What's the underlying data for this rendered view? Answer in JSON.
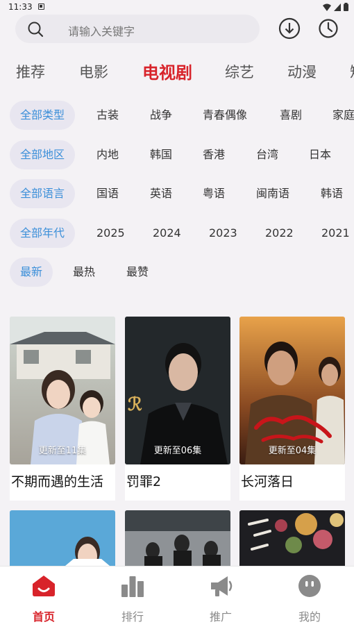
{
  "status_bar": {
    "time": "11:33"
  },
  "search": {
    "placeholder": "请输入关键字"
  },
  "tabs": [
    {
      "label": "推荐",
      "active": false
    },
    {
      "label": "电影",
      "active": false
    },
    {
      "label": "电视剧",
      "active": true
    },
    {
      "label": "综艺",
      "active": false
    },
    {
      "label": "动漫",
      "active": false
    },
    {
      "label": "短",
      "active": false
    }
  ],
  "filters": {
    "type": [
      "全部类型",
      "古装",
      "战争",
      "青春偶像",
      "喜剧",
      "家庭"
    ],
    "region": [
      "全部地区",
      "内地",
      "韩国",
      "香港",
      "台湾",
      "日本"
    ],
    "language": [
      "全部语言",
      "国语",
      "英语",
      "粤语",
      "闽南语",
      "韩语"
    ],
    "year": [
      "全部年代",
      "2025",
      "2024",
      "2023",
      "2022",
      "2021"
    ],
    "sort": [
      "最新",
      "最热",
      "最赞"
    ]
  },
  "cards": [
    {
      "title": "不期而遇的生活",
      "episode": "更新至11集",
      "poster_text": "遇\n活"
    },
    {
      "title": "罚罪2",
      "episode": "更新至06集",
      "poster_text": "罪II"
    },
    {
      "title": "长河落日",
      "episode": "更新至04集",
      "poster_text": "长河落日"
    }
  ],
  "lower_cards": [
    {
      "poster_text": ""
    },
    {
      "poster_text": ""
    },
    {
      "poster_text": "玉茗"
    }
  ],
  "bottom_nav": [
    {
      "label": "首页",
      "icon": "home-icon",
      "active": true
    },
    {
      "label": "排行",
      "icon": "bar-chart-icon",
      "active": false
    },
    {
      "label": "推广",
      "icon": "megaphone-icon",
      "active": false
    },
    {
      "label": "我的",
      "icon": "profile-face-icon",
      "active": false
    }
  ],
  "colors": {
    "accent": "#d8232a",
    "chip_active_text": "#3b8fd9",
    "chip_active_bg": "#e8e6f0"
  }
}
